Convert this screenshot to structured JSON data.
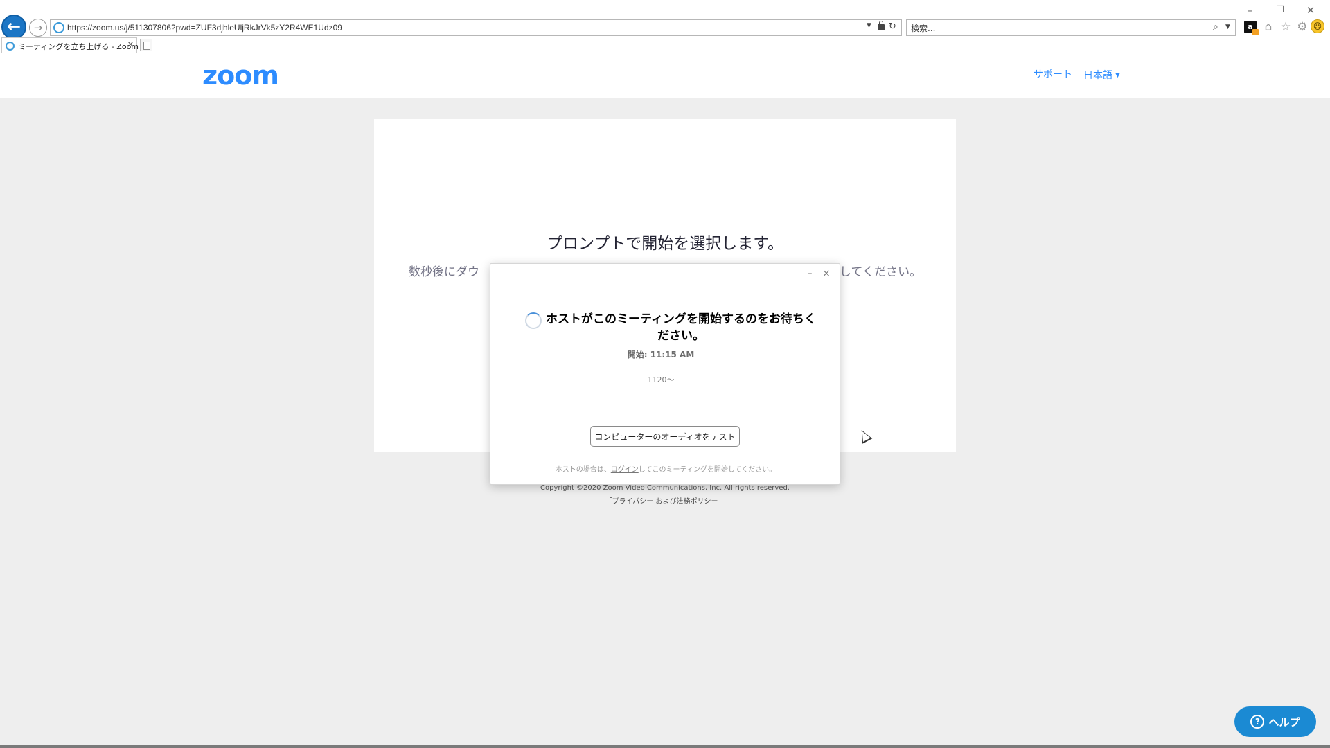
{
  "browser": {
    "url": "https://zoom.us/j/511307806?pwd=ZUF3djhleUljRkJrVk5zY2R4WE1Udz09",
    "search_placeholder": "検索...",
    "tab_title": "ミーティングを立ち上げる - Zoom",
    "window_controls": {
      "minimize": "–",
      "restore": "❐",
      "close": "✕"
    }
  },
  "header": {
    "logo": "zoom",
    "support": "サポート",
    "language": "日本語"
  },
  "main": {
    "prompt_title": "プロンプトで開始を選択します。",
    "prompt_subtext_left": "数秒後にダウ",
    "prompt_subtext_right": "してください。"
  },
  "dialog": {
    "title": "ホストがこのミーティングを開始するのをお待ちください。",
    "start_time": "開始: 11:15 AM",
    "meeting_name": "1120～",
    "test_audio_button": "コンピューターのオーディオをテスト",
    "host_note_prefix": "ホストの場合は、",
    "host_note_link": "ログイン",
    "host_note_suffix": "してこのミーティングを開始してください。"
  },
  "footer": {
    "copyright": "Copyright ©2020 Zoom Video Communications, Inc. All rights reserved.",
    "privacy": "「プライバシー および法務ポリシー」"
  },
  "help_button": "ヘルプ",
  "colors": {
    "zoom_blue": "#2d8cff",
    "help_button_blue": "#1b8ad3",
    "browser_back_blue": "#1c76c5",
    "page_background": "#eeeeee"
  }
}
